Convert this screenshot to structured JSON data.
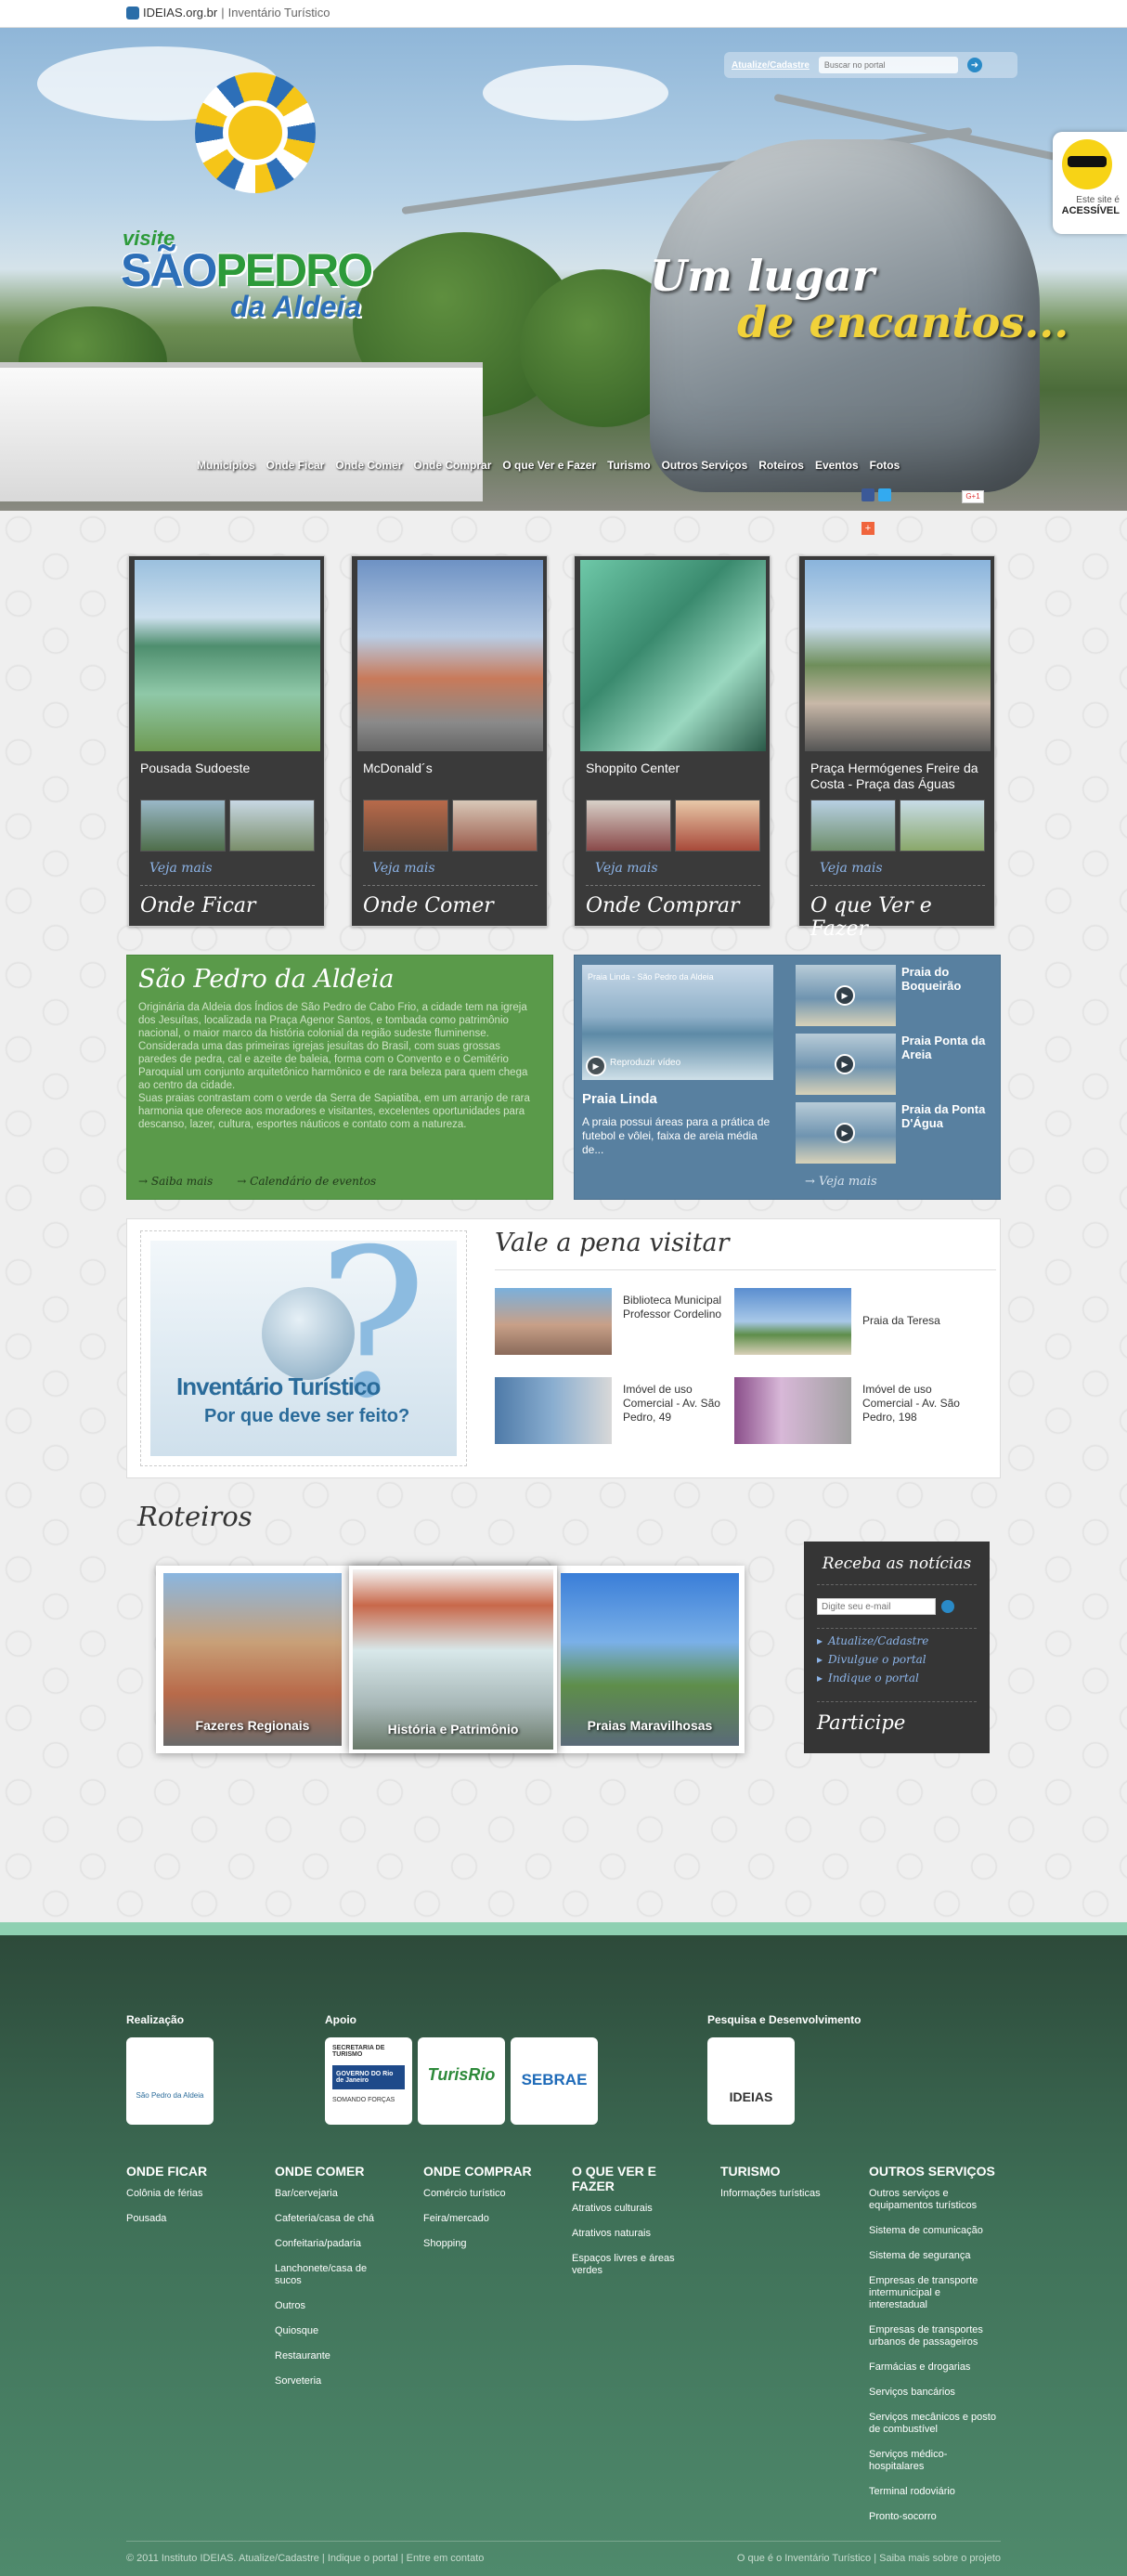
{
  "topbar": {
    "brand": "IDEIAS.org.br",
    "sep": "|",
    "section": "Inventário Turístico"
  },
  "header": {
    "update_link": "Atualize/Cadastre",
    "search_placeholder": "Buscar no portal",
    "accessible_line1": "Este site é",
    "accessible_line2": "ACESSÍVEL",
    "logo_visite": "visite",
    "logo_sao": "SÃO",
    "logo_pedro": "PEDRO",
    "logo_da_aldeia": "da Aldeia",
    "slogan_line1": "Um lugar",
    "slogan_line2": "de encantos...",
    "nav": [
      "Municípios",
      "Onde Ficar",
      "Onde Comer",
      "Onde Comprar",
      "O que Ver e Fazer",
      "Turismo",
      "Outros Serviços",
      "Roteiros",
      "Eventos",
      "Fotos"
    ],
    "gplus_label": "G+1"
  },
  "cards": [
    {
      "name": "Pousada Sudoeste",
      "more": "Veja mais",
      "category": "Onde Ficar"
    },
    {
      "name": "McDonald´s",
      "more": "Veja mais",
      "category": "Onde Comer"
    },
    {
      "name": "Shoppito Center",
      "more": "Veja mais",
      "category": "Onde Comprar"
    },
    {
      "name": "Praça Hermógenes Freire da Costa - Praça das Águas",
      "more": "Veja mais",
      "category": "O que Ver e Fazer"
    }
  ],
  "about": {
    "title": "São Pedro da Aldeia",
    "text1": "Originária da Aldeia dos Índios de São Pedro de Cabo Frio, a cidade tem na igreja dos Jesuítas, localizada na Praça Agenor Santos, e tombada como patrimônio nacional, o maior marco da história colonial da região sudeste fluminense. Considerada uma das primeiras igrejas jesuítas do Brasil, com suas grossas paredes de pedra, cal e azeite de baleia, forma com o Convento e o Cemitério Paroquial um conjunto arquitetônico harmônico e de rara beleza para quem chega ao centro da cidade.",
    "text2": "Suas praias contrastam com o verde da Serra de Sapiatiba, em um arranjo de rara harmonia que oferece aos moradores e visitantes, excelentes oportunidades para descanso, lazer, cultura, esportes náuticos e contato com a natureza.",
    "link1": "→ Saiba mais",
    "link2": "→ Calendário de eventos"
  },
  "video": {
    "main_title": "Praia Linda",
    "main_overlay": "Praia Linda - São Pedro da Aldeia",
    "main_caption": "Reproduzir vídeo",
    "main_desc": "A praia possui áreas para a prática de futebol e vôlei, faixa de areia média de...",
    "items": [
      "Praia do Boqueirão",
      "Praia Ponta da Areia",
      "Praia da Ponta D'Água"
    ],
    "more": "→ Veja mais"
  },
  "visit": {
    "banner_line1": "Inventário Turístico",
    "banner_line2": "Por que deve ser feito?",
    "title": "Vale a pena visitar",
    "places": [
      "Biblioteca Municipal Professor Cordelino",
      "Praia da Teresa",
      "Imóvel de uso Comercial - Av. São Pedro, 49",
      "Imóvel de uso Comercial - Av. São Pedro, 198"
    ]
  },
  "roteiros": {
    "title": "Roteiros",
    "items": [
      "Fazeres Regionais",
      "História e Patrimônio",
      "Praias Maravilhosas"
    ]
  },
  "news": {
    "title": "Receba as notícias",
    "email_placeholder": "Digite seu e-mail",
    "links": [
      "Atualize/Cadastre",
      "Divulgue o portal",
      "Indique o portal"
    ],
    "participe": "Participe"
  },
  "footer": {
    "realizacao": "Realização",
    "apoio": "Apoio",
    "pesquisa": "Pesquisa e Desenvolvimento",
    "logo_sp": "São Pedro da Aldeia",
    "logo_sec1": "SECRETARIA DE TURISMO",
    "logo_sec2": "GOVERNO DO Rio de Janeiro",
    "logo_sec3": "SOMANDO FORÇAS",
    "logo_turisrio": "TurisRio",
    "logo_sebrae": "SEBRAE",
    "logo_ideias": "IDEIAS",
    "columns": [
      {
        "title": "ONDE FICAR",
        "items": [
          "Colônia de férias",
          "Pousada"
        ]
      },
      {
        "title": "ONDE COMER",
        "items": [
          "Bar/cervejaria",
          "Cafeteria/casa de chá",
          "Confeitaria/padaria",
          "Lanchonete/casa de sucos",
          "Outros",
          "Quiosque",
          "Restaurante",
          "Sorveteria"
        ]
      },
      {
        "title": "ONDE COMPRAR",
        "items": [
          "Comércio turístico",
          "Feira/mercado",
          "Shopping"
        ]
      },
      {
        "title": "O QUE VER E FAZER",
        "items": [
          "Atrativos culturais",
          "Atrativos naturais",
          "Espaços livres e áreas verdes"
        ]
      },
      {
        "title": "TURISMO",
        "items": [
          "Informações turísticas"
        ]
      },
      {
        "title": "OUTROS SERVIÇOS",
        "items": [
          "Outros serviços e equipamentos turísticos",
          "Sistema de comunicação",
          "Sistema de segurança",
          "Empresas de transporte intermunicipal e interestadual",
          "Empresas de transportes urbanos de passageiros",
          "Farmácias e drogarias",
          "Serviços bancários",
          "Serviços mecânicos e posto de combustível",
          "Serviços médico-hospitalares",
          "Terminal rodoviário",
          "Pronto-socorro"
        ]
      }
    ],
    "bottom_left": "© 2011 Instituto IDEIAS. Atualize/Cadastre | Indique o portal | Entre em contato",
    "bottom_right": "O que é o Inventário Turístico | Saiba mais sobre o projeto"
  }
}
